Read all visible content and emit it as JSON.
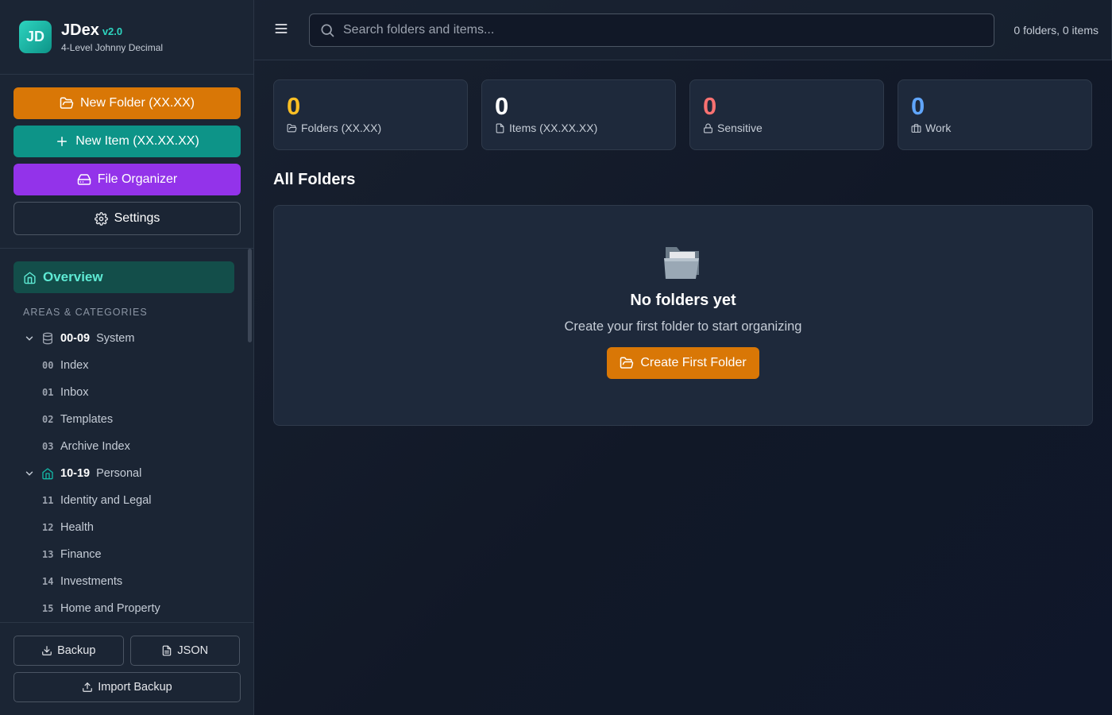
{
  "brand": {
    "logo": "JD",
    "title": "JDex",
    "version": "v2.0",
    "subtitle": "4-Level Johnny Decimal"
  },
  "actions": {
    "new_folder": "New Folder (XX.XX)",
    "new_item": "New Item (XX.XX.XX)",
    "file_organizer": "File Organizer",
    "settings": "Settings"
  },
  "nav": {
    "overview": "Overview",
    "section_label": "AREAS & CATEGORIES",
    "areas": [
      {
        "code": "00-09",
        "name": "System",
        "icon": "database-icon",
        "categories": [
          {
            "num": "00",
            "label": "Index"
          },
          {
            "num": "01",
            "label": "Inbox"
          },
          {
            "num": "02",
            "label": "Templates"
          },
          {
            "num": "03",
            "label": "Archive Index"
          }
        ]
      },
      {
        "code": "10-19",
        "name": "Personal",
        "icon": "home-icon",
        "categories": [
          {
            "num": "11",
            "label": "Identity and Legal"
          },
          {
            "num": "12",
            "label": "Health"
          },
          {
            "num": "13",
            "label": "Finance"
          },
          {
            "num": "14",
            "label": "Investments"
          },
          {
            "num": "15",
            "label": "Home and Property"
          }
        ]
      }
    ]
  },
  "footer": {
    "backup": "Backup",
    "json": "JSON",
    "import": "Import Backup"
  },
  "topbar": {
    "search_placeholder": "Search folders and items...",
    "counts": "0 folders, 0 items"
  },
  "stats": [
    {
      "value": "0",
      "label": "Folders (XX.XX)",
      "color": "#fbbf24",
      "icon": "folder-icon"
    },
    {
      "value": "0",
      "label": "Items (XX.XX.XX)",
      "color": "#ffffff",
      "icon": "file-icon"
    },
    {
      "value": "0",
      "label": "Sensitive",
      "color": "#f87171",
      "icon": "lock-icon"
    },
    {
      "value": "0",
      "label": "Work",
      "color": "#60a5fa",
      "icon": "briefcase-icon"
    }
  ],
  "main": {
    "heading": "All Folders",
    "empty_title": "No folders yet",
    "empty_subtitle": "Create your first folder to start organizing",
    "create_button": "Create First Folder"
  },
  "colors": {
    "accent": "#2dd4bf",
    "orange": "#d97706",
    "teal": "#0d9488",
    "purple": "#9333ea"
  }
}
